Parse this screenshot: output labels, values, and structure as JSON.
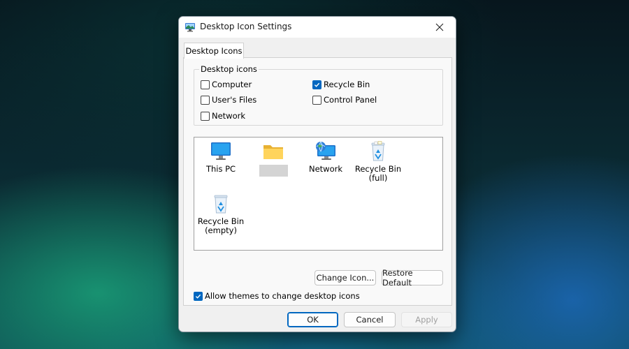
{
  "window": {
    "title": "Desktop Icon Settings",
    "icon": "display-settings-icon",
    "close_icon": "close-icon"
  },
  "tabs": [
    {
      "label": "Desktop Icons",
      "selected": true
    }
  ],
  "desktop_icons_group": {
    "label": "Desktop icons",
    "checkboxes": [
      {
        "label": "Computer",
        "checked": false
      },
      {
        "label": "User's Files",
        "checked": false
      },
      {
        "label": "Network",
        "checked": false
      },
      {
        "label": "Recycle Bin",
        "checked": true
      },
      {
        "label": "Control Panel",
        "checked": false
      }
    ]
  },
  "icon_list": [
    {
      "label": "This PC",
      "icon": "monitor-icon"
    },
    {
      "label": "",
      "icon": "folder-icon",
      "label_redacted": true
    },
    {
      "label": "Network",
      "icon": "network-icon"
    },
    {
      "label_line1": "Recycle Bin",
      "label_line2": "(full)",
      "icon": "recycle-bin-full-icon"
    },
    {
      "label_line1": "Recycle Bin",
      "label_line2": "(empty)",
      "icon": "recycle-bin-empty-icon"
    }
  ],
  "buttons": {
    "change_icon": "Change Icon...",
    "restore_default": "Restore Default",
    "ok": "OK",
    "cancel": "Cancel",
    "apply": "Apply"
  },
  "allow_themes": {
    "label": "Allow themes to change desktop icons",
    "checked": true
  },
  "colors": {
    "accent": "#0067c0",
    "dialog_bg": "#f0f0f0",
    "panel_bg": "#f9f9f9"
  }
}
